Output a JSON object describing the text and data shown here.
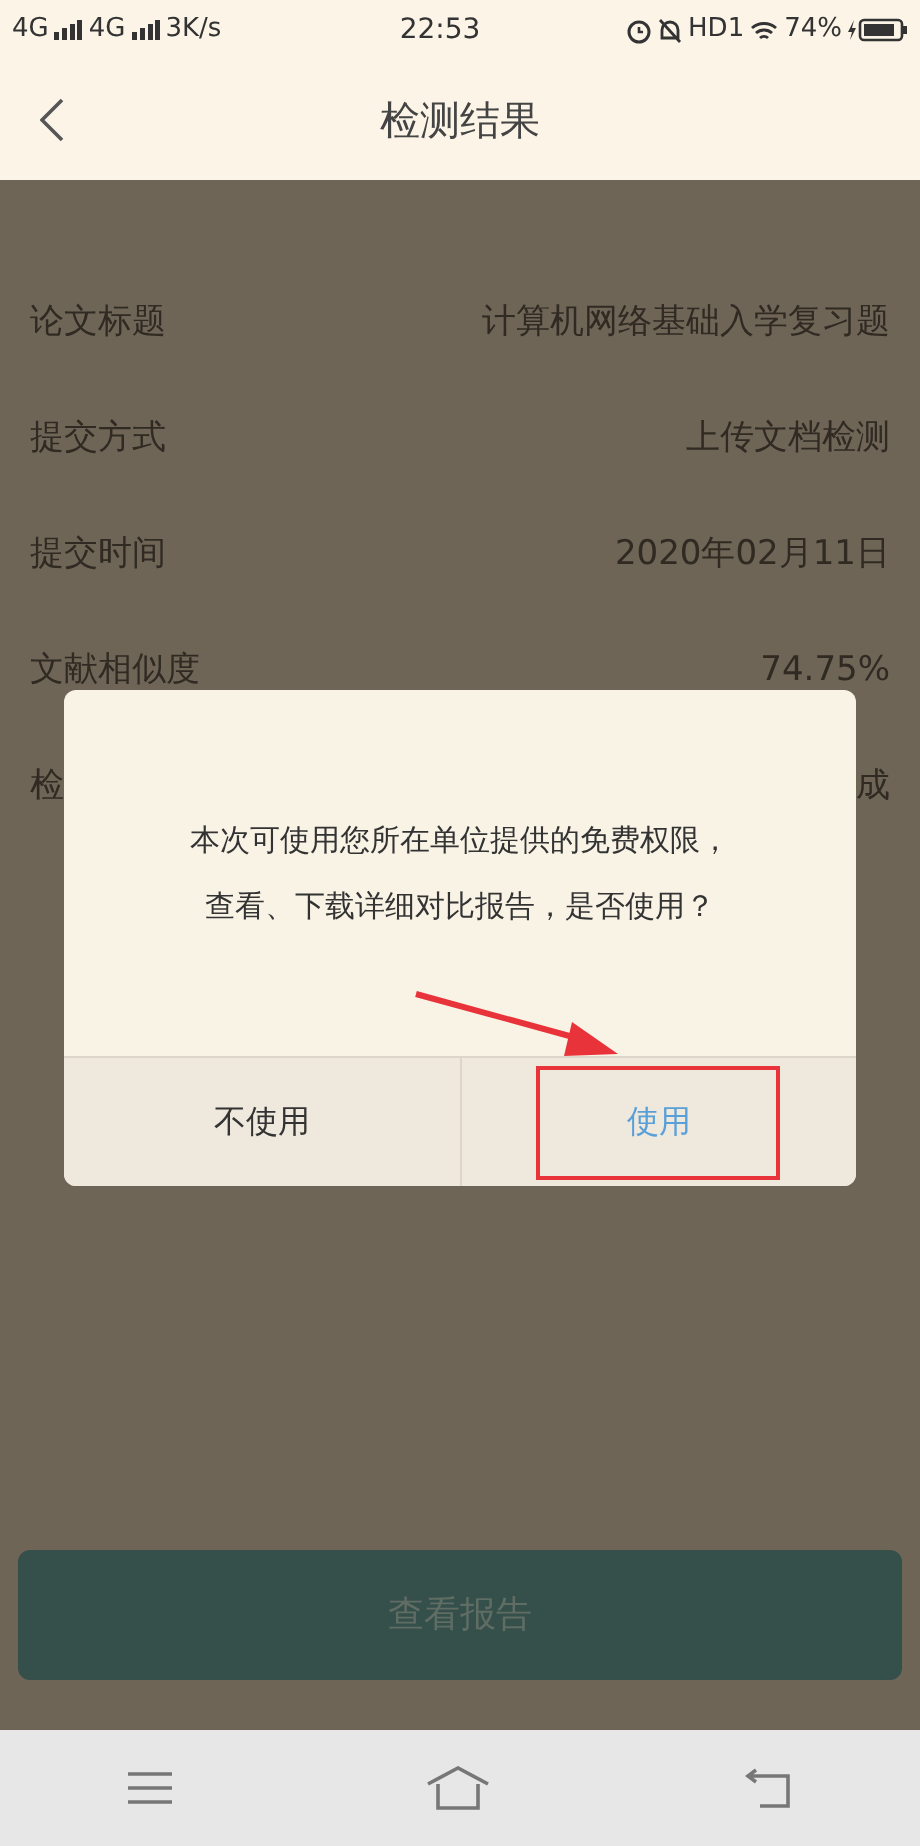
{
  "status_bar": {
    "left": [
      "4G",
      "4G",
      "3K/s"
    ],
    "time": "22:53",
    "hd": "HD1",
    "battery": "74%"
  },
  "header": {
    "title": "检测结果"
  },
  "rows": [
    {
      "label": "论文标题",
      "value": "计算机网络基础入学复习题"
    },
    {
      "label": "提交方式",
      "value": "上传文档检测"
    },
    {
      "label": "提交时间",
      "value": "2020年02月11日"
    },
    {
      "label": "文献相似度",
      "value": "74.75%"
    },
    {
      "label": "检",
      "value": "成"
    }
  ],
  "dialog": {
    "message_lines": [
      "本次可使用您所在单位提供的免费权限，",
      "查看、下载详细对比报告，是否使用？"
    ],
    "buttons": [
      {
        "label": "不使用",
        "highlighted": false
      },
      {
        "label": "使用",
        "highlighted": true
      }
    ]
  },
  "report_button": "查看报告"
}
